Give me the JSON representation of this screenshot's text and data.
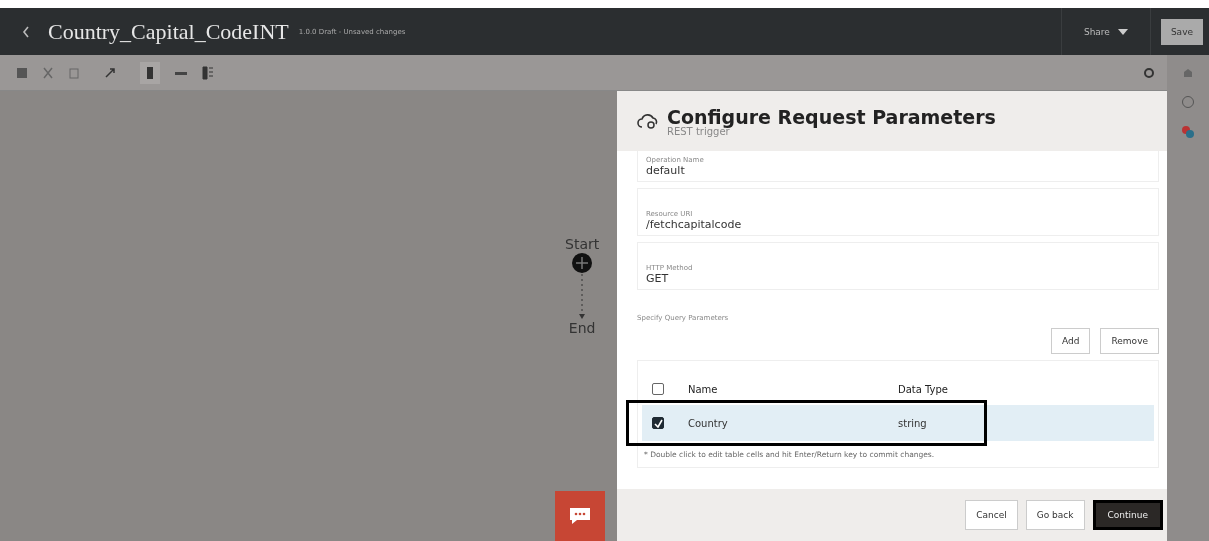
{
  "header": {
    "title": "Country_Capital_CodeINT",
    "status": "1.0.0 Draft - Unsaved changes",
    "share": "Share",
    "save": "Save"
  },
  "canvas": {
    "start": "Start",
    "end": "End"
  },
  "panel": {
    "title": "Configure Request Parameters",
    "subtitle": "REST trigger",
    "fields": [
      {
        "label": "Operation Name",
        "value": "default"
      },
      {
        "label": "Resource URI",
        "value": "/fetchcapitalcode"
      },
      {
        "label": "HTTP Method",
        "value": "GET"
      }
    ],
    "section": "Specify Query Parameters",
    "add": "Add",
    "remove": "Remove",
    "columns": [
      "Name",
      "Data Type"
    ],
    "header_checked": false,
    "rows": [
      {
        "name": "Country",
        "type": "string",
        "checked": true,
        "selected": true,
        "highlighted": true
      }
    ],
    "hint": "* Double click to edit table cells and hit Enter/Return key to commit changes.",
    "buttons": [
      {
        "label": "Cancel",
        "kind": "secondary",
        "highlighted": false
      },
      {
        "label": "Go back",
        "kind": "secondary",
        "highlighted": false
      },
      {
        "label": "Continue",
        "kind": "primary",
        "highlighted": true
      }
    ]
  }
}
